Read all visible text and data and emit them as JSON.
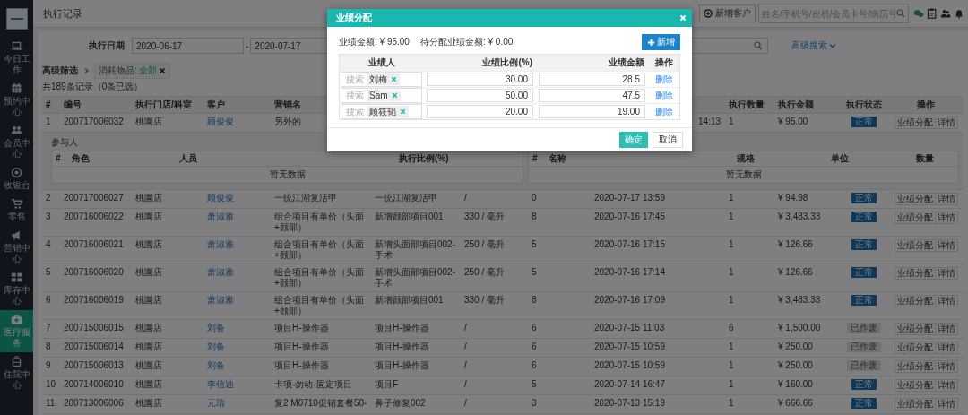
{
  "sidebar": {
    "items": [
      {
        "label": "今日工作",
        "selected": false
      },
      {
        "label": "预约中心",
        "selected": false
      },
      {
        "label": "会员中心",
        "selected": false
      },
      {
        "label": "收银台",
        "selected": false
      },
      {
        "label": "零售",
        "selected": false
      },
      {
        "label": "营销中心",
        "selected": false
      },
      {
        "label": "库存中心",
        "selected": false
      },
      {
        "label": "医疗服务",
        "selected": true
      },
      {
        "label": "住院中心",
        "selected": false
      }
    ]
  },
  "header": {
    "title": "执行记录",
    "new_customer_button": "新增客户",
    "search": {
      "placeholder": "姓名/手机号/座机/会员卡号/病历号"
    }
  },
  "filters": {
    "date_label": "执行日期",
    "date_from": "2020-06-17",
    "date_separator": "-",
    "date_to": "2020-07-17",
    "advanced_search": "高级搜索",
    "advanced_filter": "高级筛选",
    "active_filter": {
      "label": "消耗物品:",
      "value": "全部"
    },
    "record_count": "共189条记录（0条已选）"
  },
  "table": {
    "columns": [
      "#",
      "编号",
      "执行门店/科室",
      "客户",
      "营销名",
      "执行数量",
      "执行金额",
      "执行状态",
      "操作"
    ],
    "rows": [
      {
        "no": "1",
        "code": "200717006032",
        "store": "桃園店",
        "customer": "顾俊俊",
        "marketing_name": "另外的",
        "time": "14:13",
        "qty": "1",
        "amount": "¥ 95.00",
        "status": {
          "text": "正常",
          "kind": "normal"
        },
        "actions": [
          "业绩分配",
          "详情"
        ],
        "detail": {
          "title": "参与人",
          "participants": {
            "columns": [
              "#",
              "角色",
              "人员",
              "执行比例(%)"
            ],
            "empty_text": "暂无数据"
          },
          "items": {
            "columns": [
              "#",
              "名称",
              "规格",
              "单位",
              "数量"
            ],
            "empty_text": "暂无数据"
          }
        }
      },
      {
        "no": "2",
        "code": "200717006027",
        "store": "桃園店",
        "customer": "顾俊俊",
        "marketing_name": "一统江湖复活甲",
        "item_name": "一统江湖复活甲",
        "spec": "/",
        "count": "0",
        "time": "2020-07-17 13:59",
        "qty": "1",
        "amount": "¥ 94.98",
        "status": {
          "text": "正常",
          "kind": "normal"
        },
        "actions": [
          "业绩分配",
          "详情"
        ]
      },
      {
        "no": "3",
        "code": "200716006022",
        "store": "桃園店",
        "customer": "萧淑雅",
        "marketing_name": "组合项目有单价（头面+颧部）",
        "item_name": "新增颧部项目001",
        "spec": "330 / 毫升",
        "count": "8",
        "time": "2020-07-16 17:45",
        "qty": "1",
        "amount": "¥ 3,483.33",
        "status": {
          "text": "正常",
          "kind": "normal"
        },
        "actions": [
          "业绩分配",
          "详情"
        ]
      },
      {
        "no": "4",
        "code": "200716006021",
        "store": "桃園店",
        "customer": "萧淑雅",
        "marketing_name": "组合项目有单价（头面+颧部）",
        "item_name": "新增头面部项目002-手术",
        "spec": "250 / 毫升",
        "count": "5",
        "time": "2020-07-16 17:15",
        "qty": "1",
        "amount": "¥ 126.66",
        "status": {
          "text": "正常",
          "kind": "normal"
        },
        "actions": [
          "业绩分配",
          "详情"
        ]
      },
      {
        "no": "5",
        "code": "200716006020",
        "store": "桃園店",
        "customer": "萧淑雅",
        "marketing_name": "组合项目有单价（头面+颧部）",
        "item_name": "新增头面部项目002-手术",
        "spec": "250 / 毫升",
        "count": "5",
        "time": "2020-07-16 17:14",
        "qty": "1",
        "amount": "¥ 126.66",
        "status": {
          "text": "正常",
          "kind": "normal"
        },
        "actions": [
          "业绩分配",
          "详情"
        ]
      },
      {
        "no": "6",
        "code": "200716006019",
        "store": "桃園店",
        "customer": "萧淑雅",
        "marketing_name": "组合项目有单价（头面+颧部）",
        "item_name": "新增颧部项目001",
        "spec": "330 / 毫升",
        "count": "8",
        "time": "2020-07-16 17:09",
        "qty": "1",
        "amount": "¥ 3,483.33",
        "status": {
          "text": "正常",
          "kind": "normal"
        },
        "actions": [
          "业绩分配",
          "详情"
        ]
      },
      {
        "no": "7",
        "code": "200715006015",
        "store": "桃園店",
        "customer": "刘备",
        "marketing_name": "项目H-操作器",
        "item_name": "项目H-操作器",
        "spec": "/",
        "count": "6",
        "time": "2020-07-15 11:03",
        "qty": "6",
        "amount": "¥ 1,500.00",
        "status": {
          "text": "已作废",
          "kind": "void"
        },
        "actions": [
          "业绩分配",
          "详情"
        ]
      },
      {
        "no": "8",
        "code": "200715006014",
        "store": "桃園店",
        "customer": "刘备",
        "marketing_name": "项目H-操作器",
        "item_name": "项目H-操作器",
        "spec": "/",
        "count": "6",
        "time": "2020-07-15 10:59",
        "qty": "1",
        "amount": "¥ 250.00",
        "status": {
          "text": "已作废",
          "kind": "void"
        },
        "actions": [
          "业绩分配",
          "详情"
        ]
      },
      {
        "no": "9",
        "code": "200715006013",
        "store": "桃園店",
        "customer": "刘备",
        "marketing_name": "项目H-操作器",
        "item_name": "项目H-操作器",
        "spec": "/",
        "count": "6",
        "time": "2020-07-15 10:59",
        "qty": "1",
        "amount": "¥ 250.00",
        "status": {
          "text": "已作废",
          "kind": "void"
        },
        "actions": [
          "业绩分配",
          "详情"
        ]
      },
      {
        "no": "10",
        "code": "200714006010",
        "store": "桃園店",
        "customer": "李信迪",
        "marketing_name": "卡项-勿动-固定项目",
        "item_name": "项目F",
        "spec": "/",
        "count": "5",
        "time": "2020-07-14 16:47",
        "qty": "1",
        "amount": "¥ 160.00",
        "status": {
          "text": "正常",
          "kind": "normal"
        },
        "actions": [
          "业绩分配",
          "详情"
        ]
      },
      {
        "no": "11",
        "code": "200713006006",
        "store": "桃園店",
        "customer": "元瑞",
        "marketing_name": "复2 M0710促销套餐50-",
        "item_name": "鼻子修复002",
        "spec": "/",
        "count": "3",
        "time": "2020-07-13 15:19",
        "qty": "1",
        "amount": "¥ 666.66",
        "status": {
          "text": "正常",
          "kind": "normal"
        },
        "actions": [
          "业绩分配",
          "详情"
        ]
      }
    ]
  },
  "modal": {
    "title": "业绩分配",
    "performance_amount": "业绩金额: ¥ 95.00",
    "pending_amount": "待分配业绩金额: ¥ 0.00",
    "add_button": "新增",
    "columns": [
      "业绩人",
      "业绩比例(%)",
      "业绩金额",
      "操作"
    ],
    "rows": [
      {
        "placeholder": "搜索",
        "person": "刘梅",
        "ratio": "30.00",
        "amount": "28.5",
        "action": "删除"
      },
      {
        "placeholder": "搜索",
        "person": "Sam",
        "ratio": "50.00",
        "amount": "47.5",
        "action": "删除"
      },
      {
        "placeholder": "搜索",
        "person": "顾筱韬",
        "ratio": "20.00",
        "amount": "19.00",
        "action": "删除"
      }
    ],
    "confirm_button": "确定",
    "cancel_button": "取消"
  }
}
